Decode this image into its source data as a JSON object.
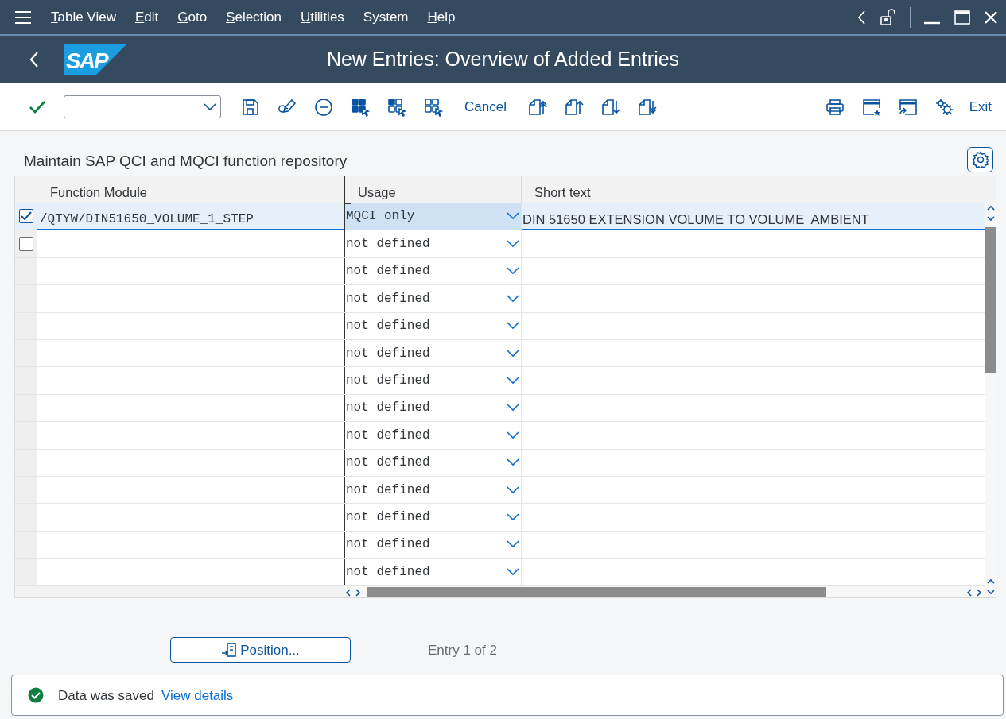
{
  "menu_bar": {
    "items": [
      {
        "label": "Table View",
        "underline_first": true
      },
      {
        "label": "Edit",
        "underline_first": true
      },
      {
        "label": "Goto",
        "underline_first": true
      },
      {
        "label": "Selection",
        "underline_first": true
      },
      {
        "label": "Utilities",
        "underline_first": true
      },
      {
        "label": "System",
        "underline_first": false
      },
      {
        "label": "Help",
        "underline_first": true
      }
    ]
  },
  "title_bar": {
    "logo": "SAP",
    "title": "New Entries: Overview of Added Entries"
  },
  "toolbar": {
    "text_buttons": [
      "Cancel",
      "Exit"
    ]
  },
  "section_title": "Maintain SAP QCI and MQCI function repository",
  "table": {
    "columns": [
      "Function Module",
      "Usage",
      "Short text"
    ],
    "rows": [
      {
        "kind": "entry",
        "checked": true,
        "selected": true,
        "function_module": "/QTYW/DIN51650_VOLUME_1_STEP",
        "usage": "MQCI only",
        "short_text": "DIN 51650 EXTENSION VOLUME TO VOLUME  AMBIENT"
      },
      {
        "kind": "entry",
        "checked": false,
        "selected": false,
        "usage": "not defined"
      },
      {
        "kind": "blank",
        "selected": false,
        "usage": "not defined"
      },
      {
        "kind": "blank",
        "selected": false,
        "usage": "not defined"
      },
      {
        "kind": "blank",
        "selected": false,
        "usage": "not defined"
      },
      {
        "kind": "blank",
        "selected": false,
        "usage": "not defined"
      },
      {
        "kind": "blank",
        "selected": false,
        "usage": "not defined"
      },
      {
        "kind": "blank",
        "selected": false,
        "usage": "not defined"
      },
      {
        "kind": "blank",
        "selected": false,
        "usage": "not defined"
      },
      {
        "kind": "blank",
        "selected": false,
        "usage": "not defined"
      },
      {
        "kind": "blank",
        "selected": false,
        "usage": "not defined"
      },
      {
        "kind": "blank",
        "selected": false,
        "usage": "not defined"
      },
      {
        "kind": "blank",
        "selected": false,
        "usage": "not defined"
      },
      {
        "kind": "blank",
        "selected": false,
        "usage": "not defined"
      }
    ]
  },
  "position_button": {
    "label": "Position..."
  },
  "entry_count": "Entry 1 of 2",
  "status_bar": {
    "kind": "success",
    "text": "Data was saved",
    "link": "View details"
  }
}
